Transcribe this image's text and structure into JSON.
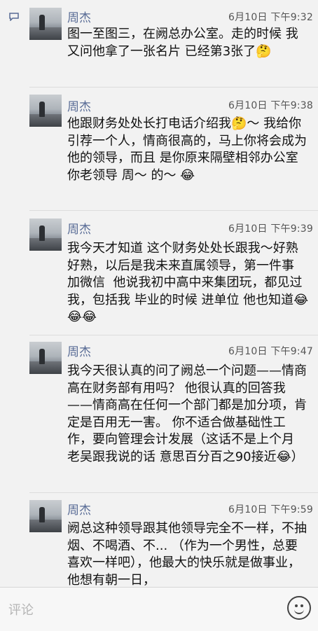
{
  "comments": [
    {
      "author": "周杰",
      "time": "6月10日 下午9:32",
      "text": "图一至图三，在阙总办公室。走的时候 我又问他拿了一张名片 已经第3张了🤔"
    },
    {
      "author": "周杰",
      "time": "6月10日 下午9:38",
      "text": "他跟财务处处长打电话介绍我🤔～ 我给你引荐一个人，情商很高的，马上你将会成为他的领导，而且 是你原来隔壁相邻办公室 你老领导 周～ 的～ 😂"
    },
    {
      "author": "周杰",
      "time": "6月10日 下午9:39",
      "text": "我今天才知道 这个财务处处长跟我～好熟好熟，以后是我未来直属领导，第一件事 加微信  他说我初中高中来集团玩，都见过我，包括我 毕业的时候 进单位 他也知道😂😂😂"
    },
    {
      "author": "周杰",
      "time": "6月10日 下午9:47",
      "text": "我今天很认真的问了阙总一个问题——情商高在财务部有用吗？ 他很认真的回答我——情商高在任何一个部门都是加分项，肯定是百用无一害。 你不适合做基础性工作，要向管理会计发展（这话不是上个月 老吴跟我说的话 意思百分百之90接近😂）"
    },
    {
      "author": "周杰",
      "time": "6月10日 下午9:59",
      "text": "阙总这种领导跟其他领导完全不一样，不抽烟、不喝酒、不... （作为一个男性，总要喜欢一样吧），他最大的快乐就是做事业，他想有朝一日，"
    }
  ],
  "input": {
    "placeholder": "评论"
  },
  "icons": {
    "comment": "comment-bubble-icon",
    "emoji": "smiley-face-icon"
  },
  "colors": {
    "author_name": "#586b95",
    "background": "#f2f2f2"
  }
}
